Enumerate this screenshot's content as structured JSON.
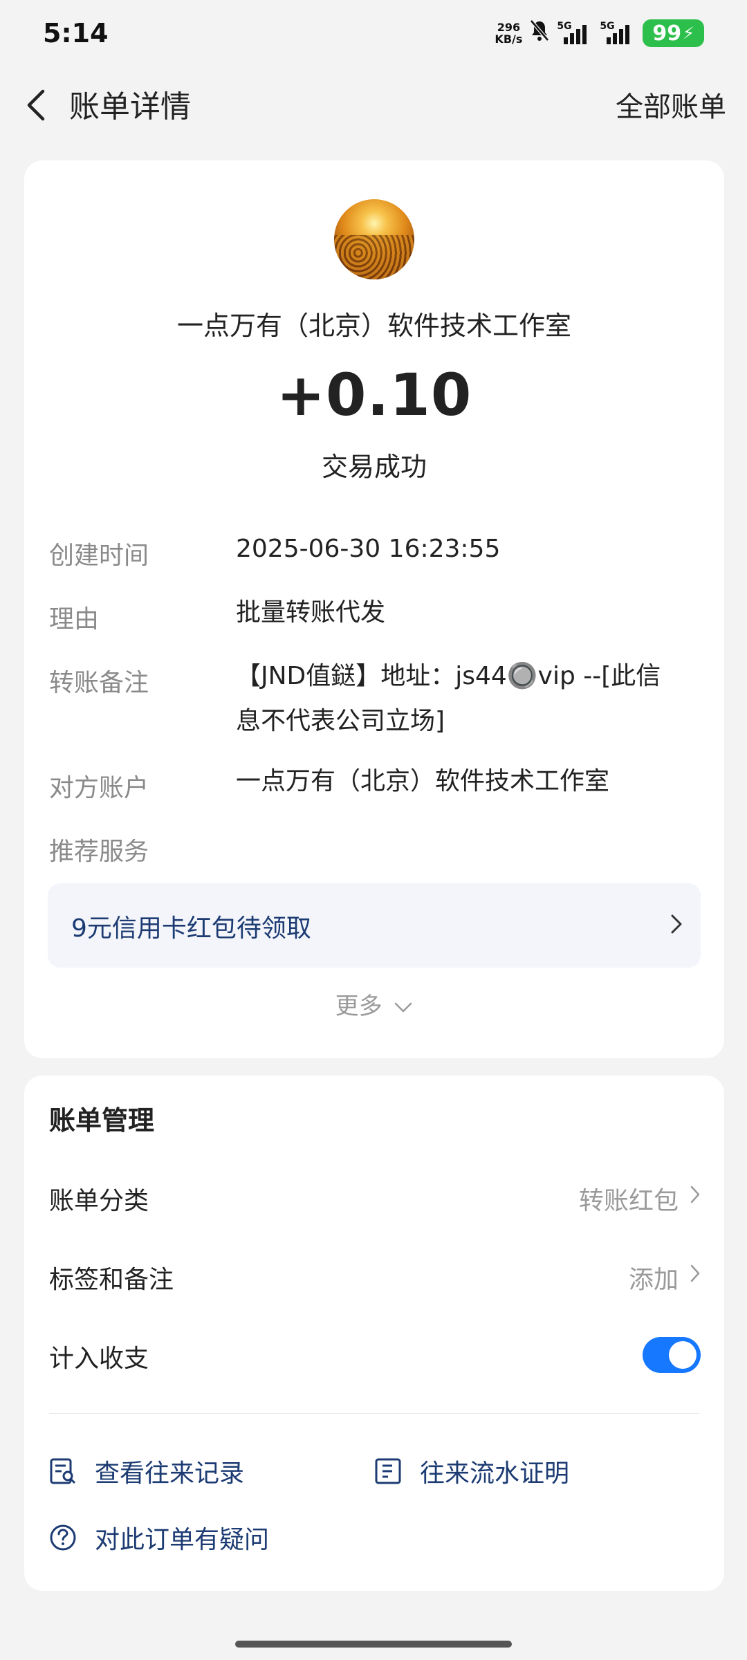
{
  "status_bar": {
    "time": "5:14",
    "net_speed_value": "296",
    "net_speed_unit": "KB/s",
    "signal1_label": "5G",
    "signal2_label": "5G",
    "battery": "99"
  },
  "header": {
    "title": "账单详情",
    "all_bills": "全部账单"
  },
  "transaction": {
    "merchant": "一点万有（北京）软件技术工作室",
    "amount": "+0.10",
    "status": "交易成功",
    "details": [
      {
        "label": "创建时间",
        "value": "2025-06-30 16:23:55"
      },
      {
        "label": "理由",
        "value": "批量转账代发"
      },
      {
        "label": "转账备注",
        "value_line1": "【JND值鎹】地址：js44🔘vip --[此信",
        "value_line2": "息不代表公司立场]"
      },
      {
        "label": "对方账户",
        "value": "一点万有（北京）软件技术工作室"
      },
      {
        "label": "推荐服务"
      }
    ],
    "promo": "9元信用卡红包待领取",
    "more": "更多"
  },
  "management": {
    "title": "账单管理",
    "category_label": "账单分类",
    "category_value": "转账红包",
    "tags_label": "标签和备注",
    "tags_value": "添加",
    "include_label": "计入收支",
    "include_enabled": true,
    "view_history": "查看往来记录",
    "statement_proof": "往来流水证明",
    "question": "对此订单有疑问"
  },
  "colors": {
    "accent": "#1677ff",
    "link": "#1c3b73",
    "battery": "#2dbf4c"
  }
}
